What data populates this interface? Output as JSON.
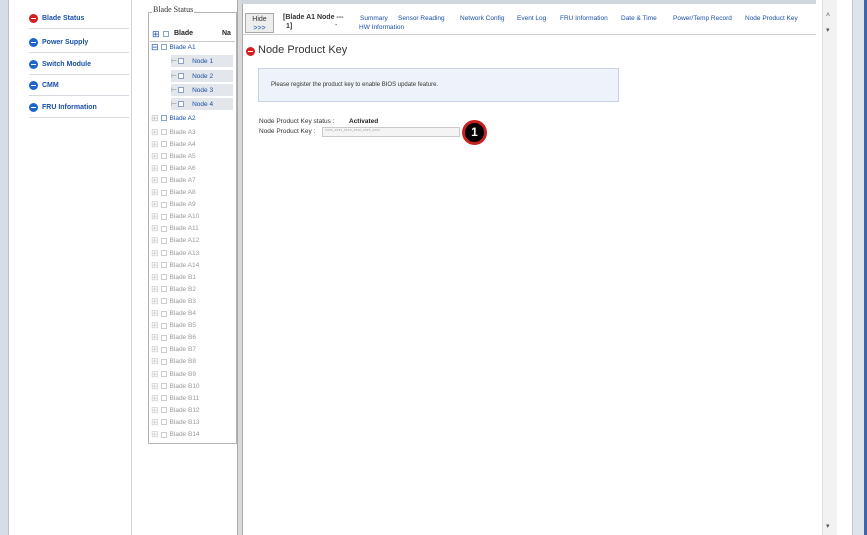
{
  "nav": {
    "items": [
      {
        "label": "Blade Status",
        "color": "#d41f1f"
      },
      {
        "label": "Power Supply",
        "color": "#1f66cc"
      },
      {
        "label": "Switch Module",
        "color": "#1f66cc"
      },
      {
        "label": "CMM",
        "color": "#1f66cc"
      },
      {
        "label": "FRU Information",
        "color": "#1f66cc"
      }
    ]
  },
  "tree": {
    "legend": "Blade Status",
    "header_blade": "Blade",
    "header_name": "Na",
    "blade_a1": "Blade A1",
    "nodes": [
      "Node 1",
      "Node 2",
      "Node 3",
      "Node 4"
    ],
    "blade_a2": "Blade A2",
    "blades_gray": [
      "Blade A3",
      "Blade A4",
      "Blade A5",
      "Blade A6",
      "Blade A7",
      "Blade A8",
      "Blade A9",
      "Blade A10",
      "Blade A11",
      "Blade A12",
      "Blade A13",
      "Blade A14",
      "Blade B1",
      "Blade B2",
      "Blade B3",
      "Blade B4",
      "Blade B5",
      "Blade B6",
      "Blade B7",
      "Blade B8",
      "Blade B9",
      "Blade B10",
      "Blade B11",
      "Blade B12",
      "Blade B13",
      "Blade B14"
    ]
  },
  "header": {
    "hide_label": "Hide",
    "hide_arrows": ">>>",
    "crumb_line1": "[Blade A1 Node ---",
    "crumb_line2": "1]",
    "crumb_dash": "-"
  },
  "tabs": [
    "Summary",
    "Sensor Reading",
    "Network Config",
    "Event Log",
    "FRU Information",
    "Date & Time",
    "Power/Temp Record",
    "Node Product Key"
  ],
  "tab_hw": "HW Information",
  "main": {
    "title": "Node Product Key",
    "info_text": "Please register the product key to enable BIOS update feature.",
    "status_label": "Node Product Key status :",
    "status_value": "Activated",
    "key_label": "Node Product Key :",
    "key_value": "****-****-****-****-****-****",
    "callout": "1"
  },
  "colors": {
    "link": "#1a4fa8",
    "accent_red": "#d41f1f",
    "info_bg": "#eef3fb"
  }
}
